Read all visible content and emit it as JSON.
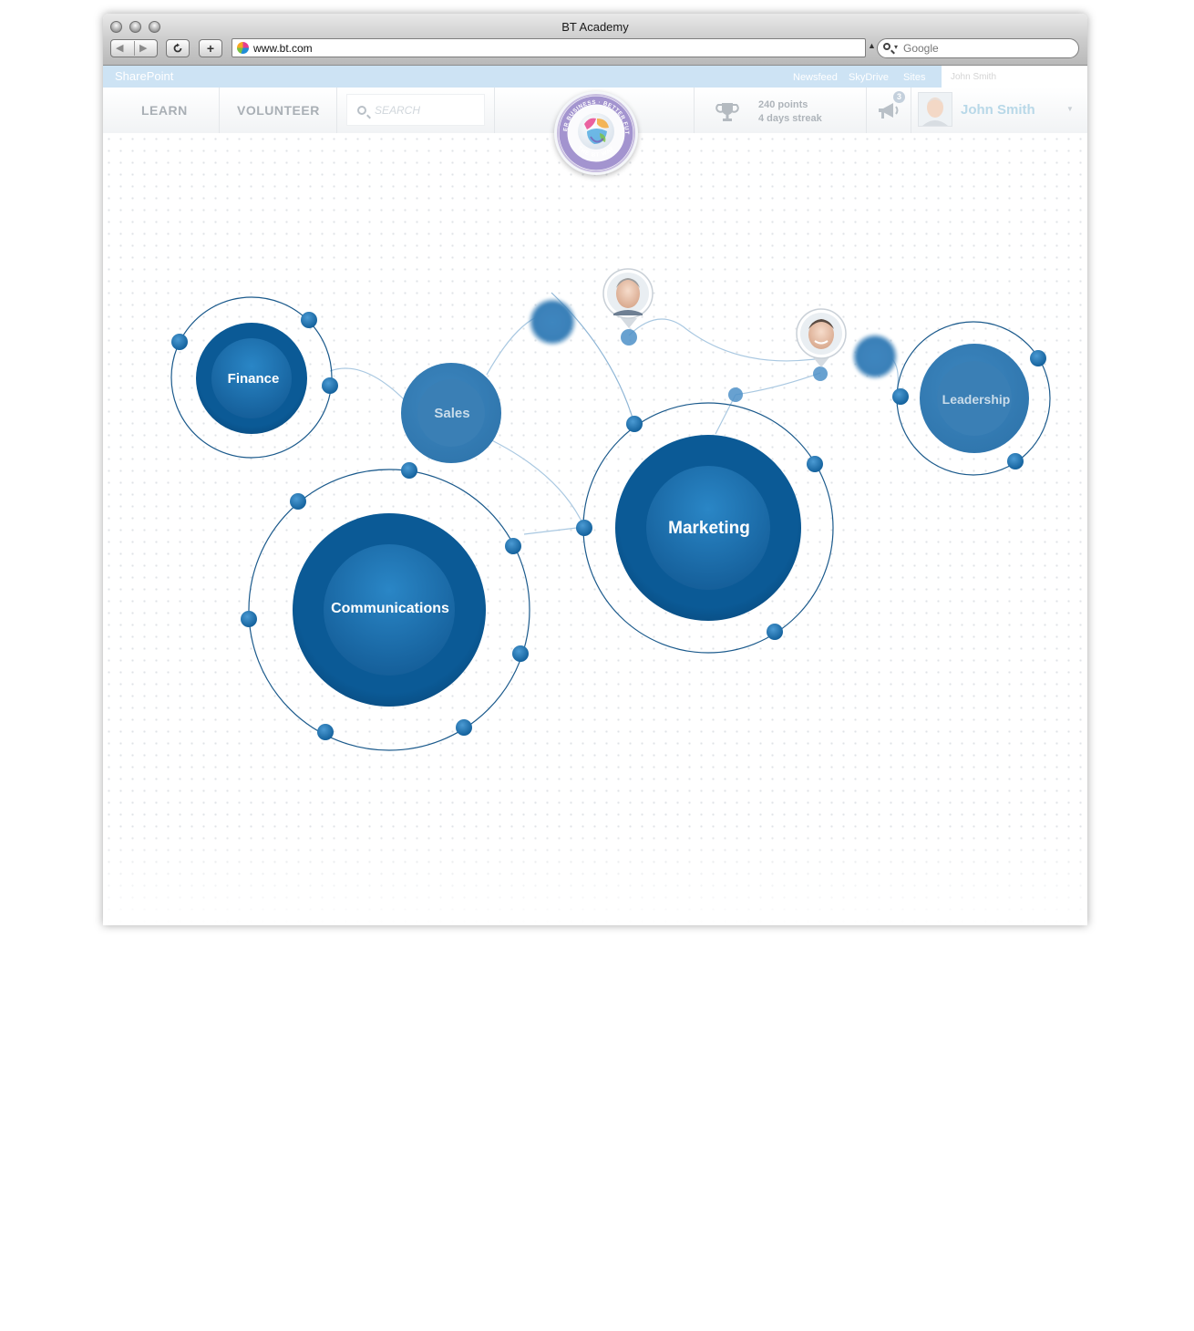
{
  "browser": {
    "window_title": "BT Academy",
    "url": "www.bt.com",
    "search_placeholder": "Google",
    "reload_icon": "reload-icon",
    "add_tab_label": "+"
  },
  "sharepoint": {
    "brand": "SharePoint",
    "links": [
      "Newsfeed",
      "SkyDrive",
      "Sites"
    ],
    "user": "John Smith"
  },
  "header": {
    "nav": [
      "LEARN",
      "VOLUNTEER"
    ],
    "search_placeholder": "SEARCH",
    "points": "240 points",
    "streak": "4 days streak",
    "notifications": "3",
    "user_name": "John Smith",
    "logo_top_text": "BETTER BUSINESS · BETTER FUTURE",
    "logo_bottom_text": "THE BT WAY"
  },
  "graph": {
    "nodes": [
      "Finance",
      "Sales",
      "Communications",
      "Marketing",
      "Leadership"
    ]
  },
  "colors": {
    "primary": "#0b5a96",
    "node_inner": "#1b74b4",
    "node_light": "#2f75ac",
    "ring": "#1b5a8c",
    "sharepoint_bar": "#cde3f4",
    "accent_user": "#b8d8e8"
  }
}
